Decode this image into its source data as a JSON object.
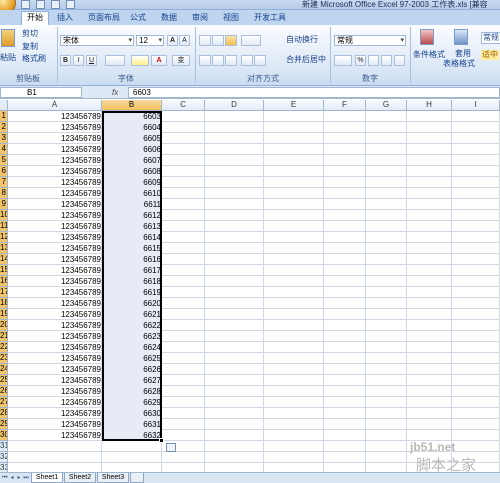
{
  "window": {
    "title": "新建 Microsoft Office Excel 97-2003 工作表.xls [兼容"
  },
  "ribbon_tabs": [
    "开始",
    "插入",
    "页面布局",
    "公式",
    "数据",
    "审阅",
    "视图",
    "开发工具"
  ],
  "ribbon": {
    "clipboard": {
      "paste_label": "粘贴",
      "cut_label": "剪切",
      "copy_label": "复制",
      "format_painter_label": "格式刷",
      "group_label": "剪贴板"
    },
    "font": {
      "font_name": "宋体",
      "font_size": "12",
      "bold_label": "B",
      "italic_label": "I",
      "underline_label": "U",
      "grow_label": "A",
      "shrink_label": "A",
      "font_color_label": "A",
      "wen_label": "变",
      "group_label": "字体"
    },
    "alignment": {
      "wrap_label": "自动换行",
      "merge_label": "合并后居中",
      "group_label": "对齐方式"
    },
    "number": {
      "format": "常规",
      "percent_label": "%",
      "group_label": "数字"
    },
    "styles": {
      "conditional_label": "条件格式",
      "table_label": "套用",
      "table_format_label": "表格格式",
      "style_normal_label": "常规",
      "style_fit_label": "适中"
    }
  },
  "formula_bar": {
    "name_box": "B1",
    "fx_label": "fx",
    "formula": "6603"
  },
  "grid": {
    "columns": [
      "A",
      "B",
      "C",
      "D",
      "E",
      "F",
      "G",
      "H",
      "I"
    ],
    "selected_column": "B",
    "row_numbers": [
      "1",
      "2",
      "3",
      "4",
      "5",
      "6",
      "7",
      "8",
      "9",
      "10",
      "11",
      "12",
      "13",
      "14",
      "15",
      "16",
      "17",
      "18",
      "19",
      "20",
      "21",
      "22",
      "23",
      "24",
      "25",
      "26",
      "27",
      "28",
      "29",
      "30",
      "31",
      "32",
      "33"
    ],
    "col_a_values": [
      "123456789",
      "123456789",
      "123456789",
      "123456789",
      "123456789",
      "123456789",
      "123456789",
      "123456789",
      "123456789",
      "123456789",
      "123456789",
      "123456789",
      "123456789",
      "123456789",
      "123456789",
      "123456789",
      "123456789",
      "123456789",
      "123456789",
      "123456789",
      "123456789",
      "123456789",
      "123456789",
      "123456789",
      "123456789",
      "123456789",
      "123456789",
      "123456789",
      "123456789",
      "123456789"
    ],
    "col_b_values": [
      "6603",
      "6604",
      "6605",
      "6606",
      "6607",
      "6608",
      "6609",
      "6610",
      "6611",
      "6612",
      "6613",
      "6614",
      "6615",
      "6616",
      "6617",
      "6618",
      "6619",
      "6620",
      "6621",
      "6622",
      "6623",
      "6624",
      "6625",
      "6626",
      "6627",
      "6628",
      "6629",
      "6630",
      "6631",
      "6632"
    ]
  },
  "sheets": [
    "Sheet1",
    "Sheet2",
    "Sheet3"
  ],
  "active_sheet": "Sheet1",
  "watermark": {
    "url": "jb51.net",
    "name": "脚本之家"
  }
}
